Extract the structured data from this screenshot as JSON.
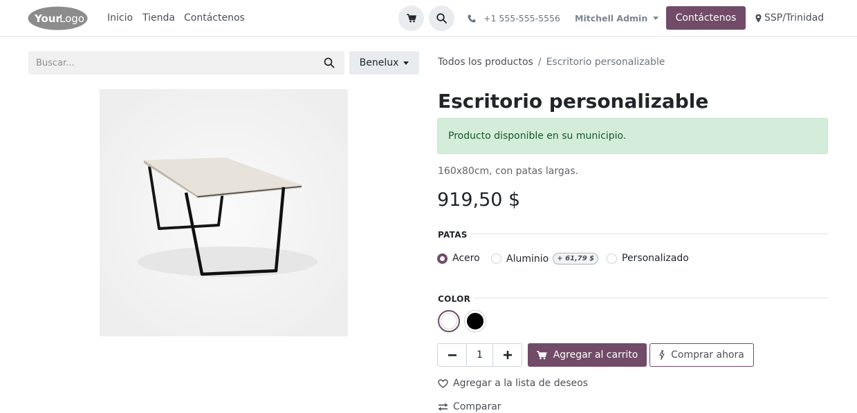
{
  "header": {
    "logo": "YourLogo",
    "nav": [
      "Inicio",
      "Tienda",
      "Contáctenos"
    ],
    "phone": "+1 555-555-5556",
    "user": "Mitchell Admin",
    "contact_button": "Contáctenos",
    "location": "SSP/Trinidad"
  },
  "search": {
    "placeholder": "Buscar...",
    "pricelist": "Benelux"
  },
  "breadcrumb": {
    "parent": "Todos los productos",
    "separator": "/",
    "current": "Escritorio personalizable"
  },
  "product": {
    "name": "Escritorio personalizable",
    "availability": "Producto disponible en su municipio.",
    "description": "160x80cm, con patas largas.",
    "price": "919,50 $"
  },
  "attributes": {
    "legs": {
      "label": "PATAS",
      "options": [
        {
          "label": "Acero",
          "selected": true
        },
        {
          "label": "Aluminio",
          "extra": "+ 61,79 $",
          "selected": false
        },
        {
          "label": "Personalizado",
          "selected": false
        }
      ]
    },
    "color": {
      "label": "COLOR",
      "options": [
        {
          "color": "#ffffff",
          "selected": true
        },
        {
          "color": "#000000",
          "selected": false
        }
      ]
    }
  },
  "actions": {
    "quantity": "1",
    "add_to_cart": "Agregar al carrito",
    "buy_now": "Comprar ahora",
    "wishlist": "Agregar a la lista de deseos",
    "compare": "Comparar"
  },
  "colors": {
    "primary": "#714b67",
    "success_bg": "#d4edda",
    "success_text": "#155724"
  }
}
